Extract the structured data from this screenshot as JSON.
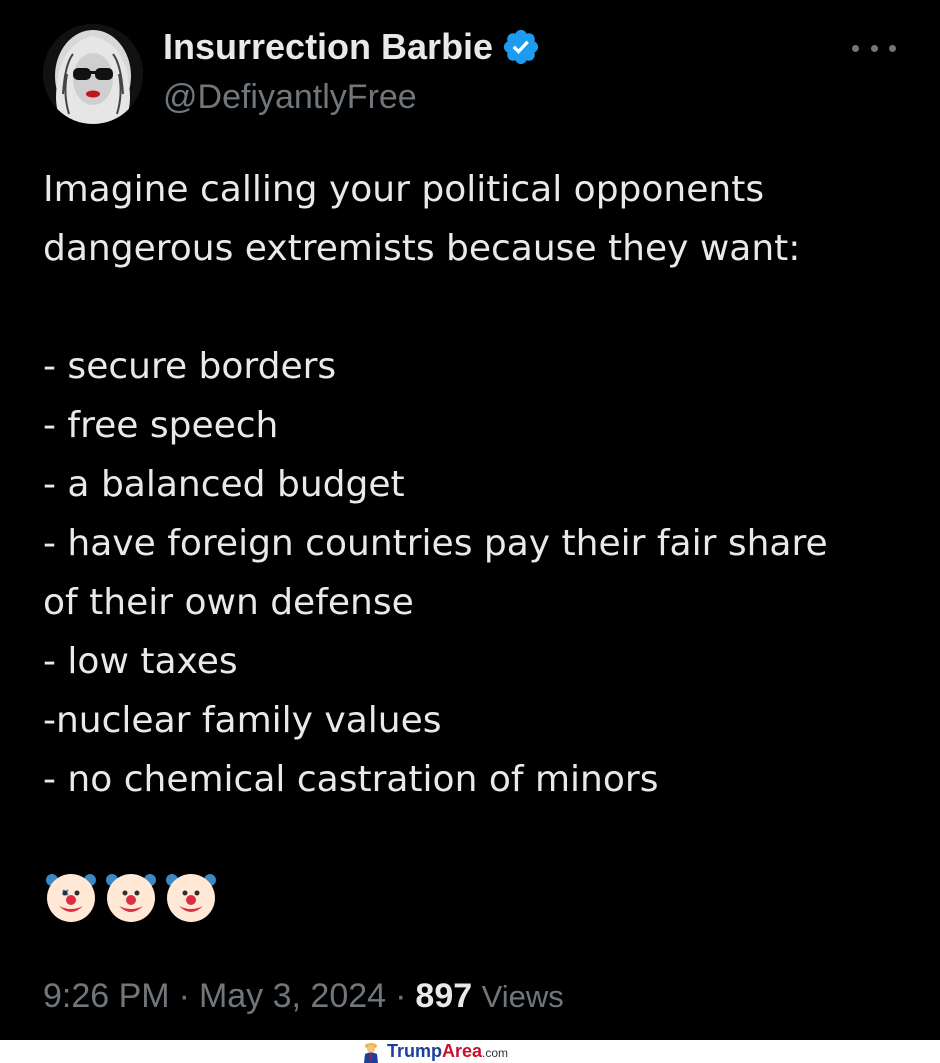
{
  "tweet": {
    "author": {
      "display_name": "Insurrection Barbie",
      "handle": "@DefiyantlyFree",
      "avatar_icon": "avatar-icon",
      "verified_icon": "verified-badge-icon",
      "verified_color": "#1d9bf0"
    },
    "more_icon": "more-options-icon",
    "lines": [
      "Imagine calling your political opponents",
      "dangerous extremists because they want:",
      "",
      "- secure borders",
      "- free speech",
      "- a balanced budget",
      "- have foreign countries pay their fair share",
      "of their own defense",
      "- low taxes",
      "-nuclear family values",
      "- no chemical castration of minors"
    ],
    "emojis": [
      "🤡",
      "🤡",
      "🤡"
    ],
    "meta": {
      "time": "9:26 PM",
      "separator": "·",
      "date": "May 3, 2024",
      "views_count": "897",
      "views_label": "Views"
    }
  },
  "watermark": {
    "text_main": "Trump",
    "text_accent": "Area",
    "text_suffix": ".com"
  },
  "colors": {
    "background": "#000000",
    "text_primary": "#e7e9ea",
    "text_secondary": "#71767b",
    "accent": "#1d9bf0"
  }
}
